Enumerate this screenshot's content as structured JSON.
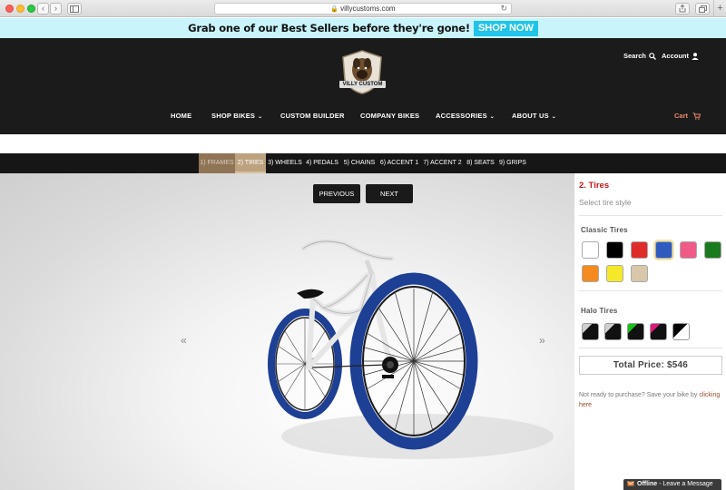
{
  "browser": {
    "url": "villycustoms.com",
    "back_label": "‹",
    "forward_label": "›",
    "new_tab_label": "+"
  },
  "promo": {
    "text": "Grab one of our Best Sellers before they're gone!",
    "button": "SHOP NOW"
  },
  "header": {
    "logo_text": "VILLY CUSTOM",
    "search_label": "Search",
    "account_label": "Account",
    "nav": [
      {
        "label": "HOME",
        "has_menu": false
      },
      {
        "label": "SHOP BIKES",
        "has_menu": true
      },
      {
        "label": "CUSTOM BUILDER",
        "has_menu": false
      },
      {
        "label": "COMPANY BIKES",
        "has_menu": false
      },
      {
        "label": "ACCESSORIES",
        "has_menu": true
      },
      {
        "label": "ABOUT US",
        "has_menu": true
      }
    ],
    "cart_label": "Cart"
  },
  "steps": [
    {
      "label": "1) FRAMES",
      "state": "done"
    },
    {
      "label": "2) TIRES",
      "state": "active"
    },
    {
      "label": "3) WHEELS",
      "state": "todo"
    },
    {
      "label": "4) PEDALS",
      "state": "todo"
    },
    {
      "label": "5) CHAINS",
      "state": "todo"
    },
    {
      "label": "6) ACCENT 1",
      "state": "todo"
    },
    {
      "label": "7) ACCENT 2",
      "state": "todo"
    },
    {
      "label": "8) SEATS",
      "state": "todo"
    },
    {
      "label": "9) GRIPS",
      "state": "todo"
    }
  ],
  "preview": {
    "previous_label": "PREVIOUS",
    "next_label": "NEXT",
    "left_arrow": "«",
    "right_arrow": "»"
  },
  "panel": {
    "title": "2. Tires",
    "subtitle": "Select tire style",
    "classic_title": "Classic Tires",
    "classic_colors": [
      "#ffffff",
      "#000000",
      "#e02b2b",
      "#2f5bbf",
      "#ef5a86",
      "#1a7a1e",
      "#d9a6ef",
      "#f58a1f",
      "#f5e829",
      "#d8c7ab"
    ],
    "selected_classic_index": 3,
    "halo_title": "Halo Tires",
    "halo_colors": [
      "#d0d0d0",
      "#d0d0d0",
      "#17c017",
      "#e0197e",
      "#000000"
    ],
    "total_label": "Total Price: $546",
    "note_text": "Not ready to purchase? Save your bike by",
    "note_link": "clicking here"
  },
  "chat": {
    "status": "Offline",
    "message": "- Leave a Message"
  }
}
